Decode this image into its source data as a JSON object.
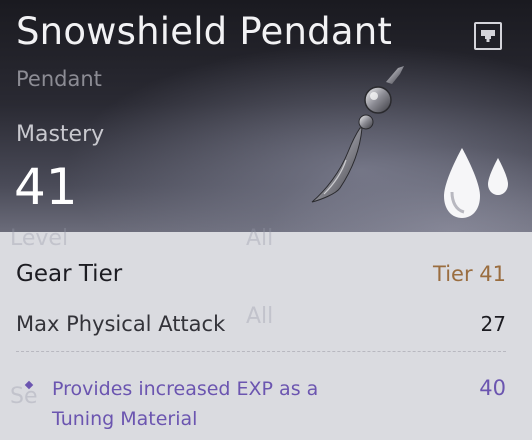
{
  "item": {
    "name": "Snowshield Pendant",
    "type": "Pendant",
    "mastery_label": "Mastery",
    "mastery_value": "41"
  },
  "icons": {
    "info": "info-card-icon",
    "item": "pendant-item-icon",
    "element": "water-drops-icon"
  },
  "background_ghost": {
    "level_label": "Level",
    "level_value": "All",
    "row2_value": "All",
    "row3_label": "Se"
  },
  "stats": {
    "gear_tier_label": "Gear Tier",
    "gear_tier_value": "Tier 41",
    "max_physical_attack_label": "Max Physical Attack",
    "max_physical_attack_value": "27"
  },
  "effect": {
    "text": "Provides increased EXP as a Tuning Material",
    "value": "40"
  },
  "colors": {
    "tier": "#9a6d3f",
    "effect": "#6b55b0",
    "panel": "#dadbe0"
  }
}
